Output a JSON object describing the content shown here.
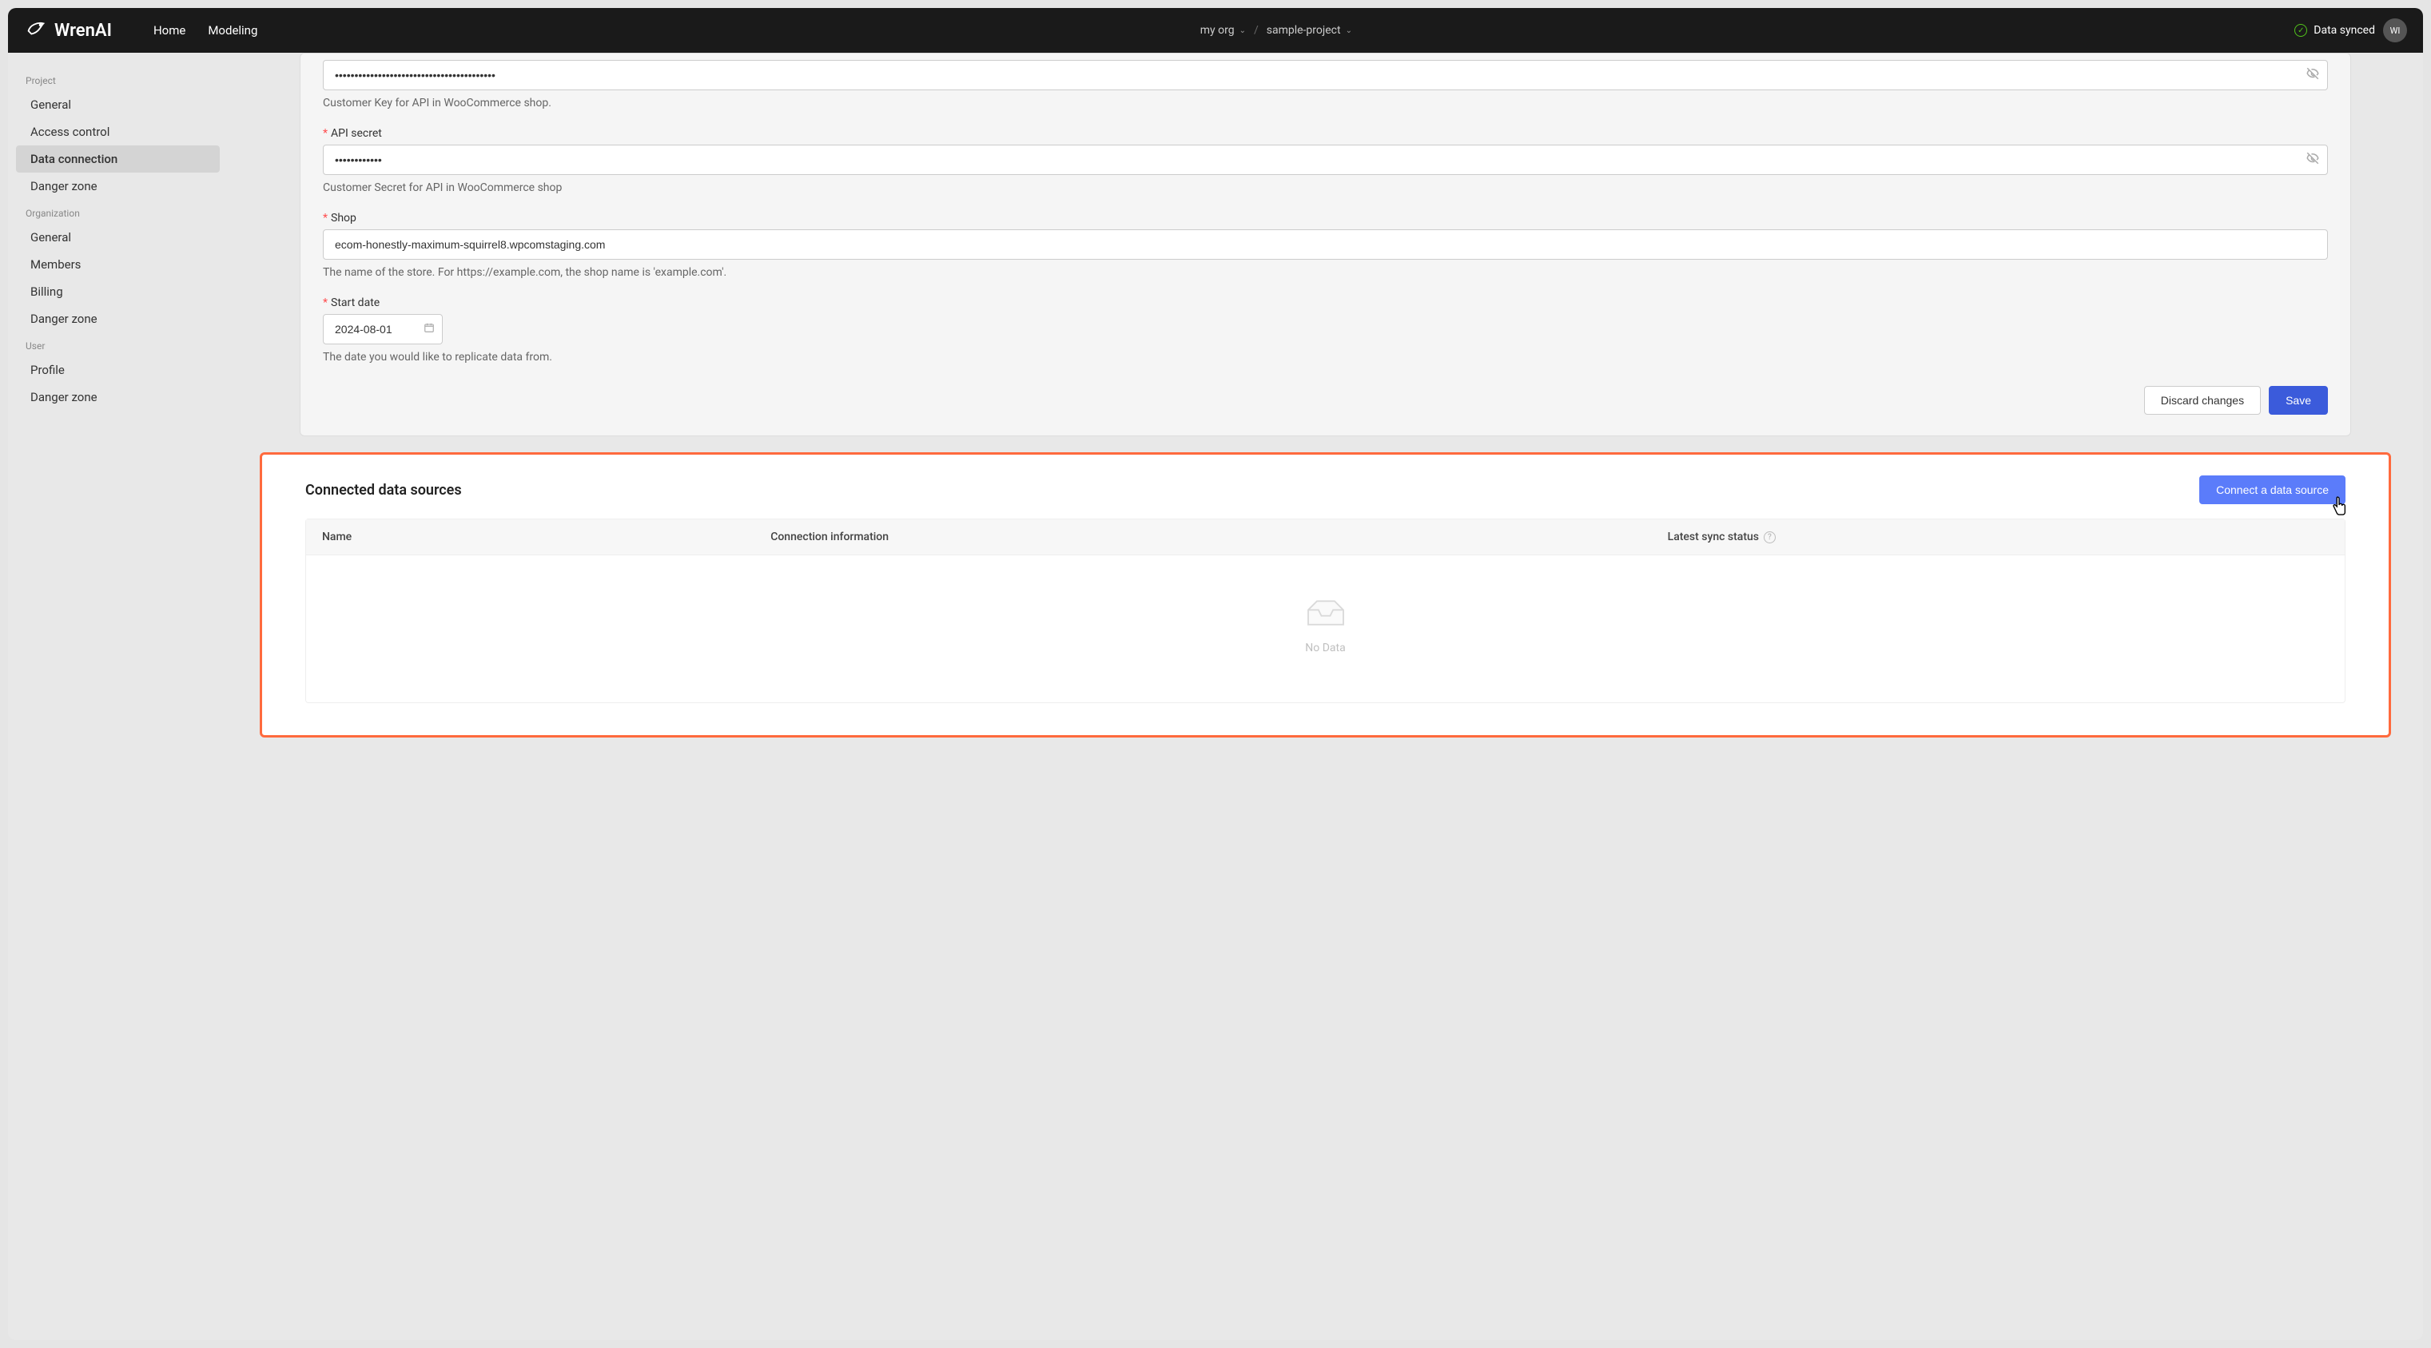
{
  "header": {
    "brand": "WrenAI",
    "nav": {
      "home": "Home",
      "modeling": "Modeling"
    },
    "crumbs": {
      "org": "my org",
      "project": "sample-project"
    },
    "sync_status": "Data synced",
    "avatar_initials": "WI"
  },
  "sidebar": {
    "sections": [
      {
        "title": "Project",
        "items": [
          "General",
          "Access control",
          "Data connection",
          "Danger zone"
        ],
        "active_index": 2
      },
      {
        "title": "Organization",
        "items": [
          "General",
          "Members",
          "Billing",
          "Danger zone"
        ]
      },
      {
        "title": "User",
        "items": [
          "Profile",
          "Danger zone"
        ]
      }
    ]
  },
  "form": {
    "api_key": {
      "value": "•••••••••••••••••••••••••••••••••••••••••",
      "help": "Customer Key for API in WooCommerce shop."
    },
    "api_secret": {
      "label": "API secret",
      "value": "••••••••••••",
      "help": "Customer Secret for API in WooCommerce shop"
    },
    "shop": {
      "label": "Shop",
      "value": "ecom-honestly-maximum-squirrel8.wpcomstaging.com",
      "help": "The name of the store. For https://example.com, the shop name is 'example.com'."
    },
    "start_date": {
      "label": "Start date",
      "value": "2024-08-01",
      "help": "The date you would like to replicate data from."
    },
    "actions": {
      "discard": "Discard changes",
      "save": "Save"
    }
  },
  "connected_panel": {
    "title": "Connected data sources",
    "connect_btn": "Connect a data source",
    "columns": {
      "name": "Name",
      "conn": "Connection information",
      "sync": "Latest sync status"
    },
    "empty_text": "No Data"
  }
}
